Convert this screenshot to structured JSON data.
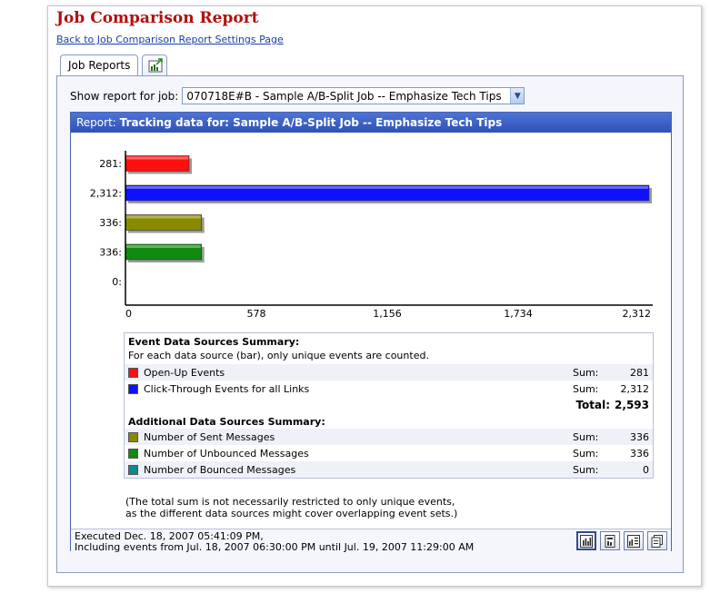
{
  "page": {
    "title": "Job Comparison Report",
    "back_link": "Back to Job Comparison Report Settings Page"
  },
  "tabs": [
    {
      "label": "Job Reports",
      "active": true
    },
    {
      "label": "",
      "icon": "chart-export-icon",
      "active": false
    }
  ],
  "job_select": {
    "label": "Show report for job:",
    "value": "070718E#B - Sample A/B-Split Job -- Emphasize Tech Tips"
  },
  "report": {
    "header_prefix": "Report:",
    "header_title": "Tracking data for: Sample A/B-Split Job -- Emphasize Tech Tips"
  },
  "chart_data": {
    "type": "bar",
    "orientation": "horizontal",
    "categories": [
      "Open-Up Events",
      "Click-Through Events for all Links",
      "Number of Sent Messages",
      "Number of Unbounced Messages",
      "Number of Bounced Messages"
    ],
    "values": [
      281,
      2312,
      336,
      336,
      0
    ],
    "value_labels": [
      "281:",
      "2,312:",
      "336:",
      "336:",
      "0:"
    ],
    "colors": [
      "#ff1010",
      "#1010ff",
      "#8a8a00",
      "#108a10",
      "#108a8a"
    ],
    "xlim": [
      0,
      2312
    ],
    "xticks": [
      0,
      578,
      1156,
      1734,
      2312
    ],
    "xtick_labels": [
      "0",
      "578",
      "1,156",
      "1,734",
      "2,312"
    ],
    "grid": false
  },
  "summary": {
    "event_heading": "Event Data Sources Summary:",
    "event_note": "For each data source (bar), only unique events are counted.",
    "event_rows": [
      {
        "label": "Open-Up Events",
        "key": "Sum:",
        "value": "281",
        "color": "#ff1010"
      },
      {
        "label": "Click-Through Events for all Links",
        "key": "Sum:",
        "value": "2,312",
        "color": "#1010ff"
      }
    ],
    "total_label": "Total:",
    "total_value": "2,593",
    "additional_heading": "Additional Data Sources Summary:",
    "additional_rows": [
      {
        "label": "Number of Sent Messages",
        "key": "Sum:",
        "value": "336",
        "color": "#8a8a00"
      },
      {
        "label": "Number of Unbounced Messages",
        "key": "Sum:",
        "value": "336",
        "color": "#108a10"
      },
      {
        "label": "Number of Bounced Messages",
        "key": "Sum:",
        "value": "0",
        "color": "#108a8a"
      }
    ]
  },
  "footnote": {
    "line1": "(The total sum is not necessarily restricted to only unique events,",
    "line2": "as the different data sources might cover overlapping event sets.)"
  },
  "execution": {
    "line1": "Executed Dec. 18, 2007 05:41:09 PM,",
    "line2": "Including events from Jul. 18, 2007 06:30:00 PM until Jul. 19, 2007 11:29:00 AM"
  },
  "view_buttons": [
    {
      "icon": "bar-chart-icon",
      "active": true
    },
    {
      "icon": "report-detail-icon",
      "active": false
    },
    {
      "icon": "chart-table-icon",
      "active": false
    },
    {
      "icon": "copy-icon",
      "active": false
    }
  ]
}
